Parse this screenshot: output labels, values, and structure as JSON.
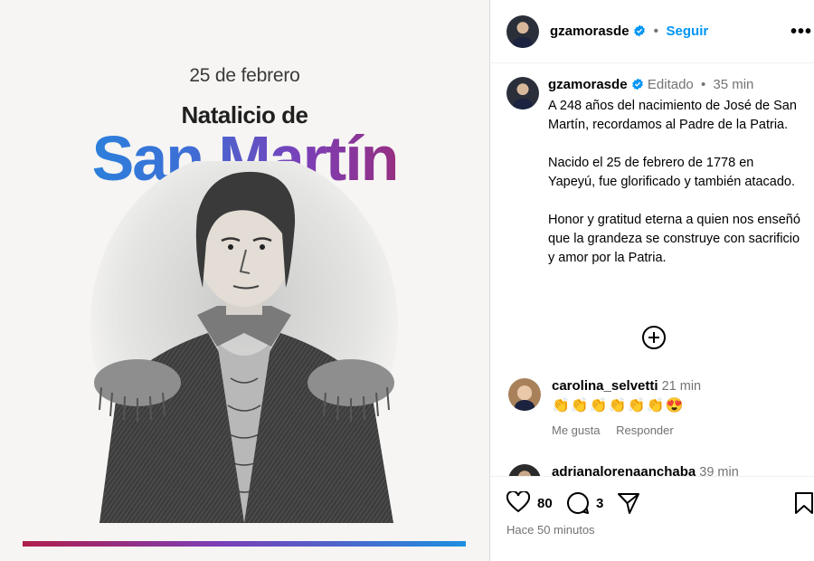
{
  "image": {
    "date": "25 de febrero",
    "subtitle": "Natalicio de",
    "title": "San Martín"
  },
  "header": {
    "username": "gzamorasde",
    "separator": "•",
    "follow_label": "Seguir",
    "more_label": "•••"
  },
  "caption": {
    "username": "gzamorasde",
    "edited": "Editado",
    "separator": "•",
    "time": "35 min",
    "text": "A 248 años del nacimiento de José de San Martín, recordamos al Padre de la Patria.\n\nNacido el 25 de febrero de 1778 en Yapeyú, fue glorificado y también atacado.\n\nHonor y gratitud eterna a quien nos enseñó que la grandeza se construye con sacrificio y amor por la Patria."
  },
  "comments": [
    {
      "username": "carolina_selvetti",
      "time": "21 min",
      "text": "👏👏👏👏👏👏😍",
      "like_label": "Me gusta",
      "reply_label": "Responder"
    },
    {
      "username": "adrianalorenaanchaba",
      "time": "39 min"
    }
  ],
  "actions": {
    "likes": "80",
    "comments": "3",
    "timestamp": "Hace 50 minutos"
  },
  "colors": {
    "accent": "#0095f6",
    "verified": "#0095f6",
    "meta": "#737373",
    "gradient_blue": "#1d8fe0",
    "gradient_purple": "#7b3fb8",
    "gradient_red": "#b01e4c"
  },
  "icons": [
    "verified-badge-icon",
    "more-options-icon",
    "add-circle-icon",
    "heart-icon",
    "comment-icon",
    "share-icon",
    "bookmark-icon"
  ]
}
